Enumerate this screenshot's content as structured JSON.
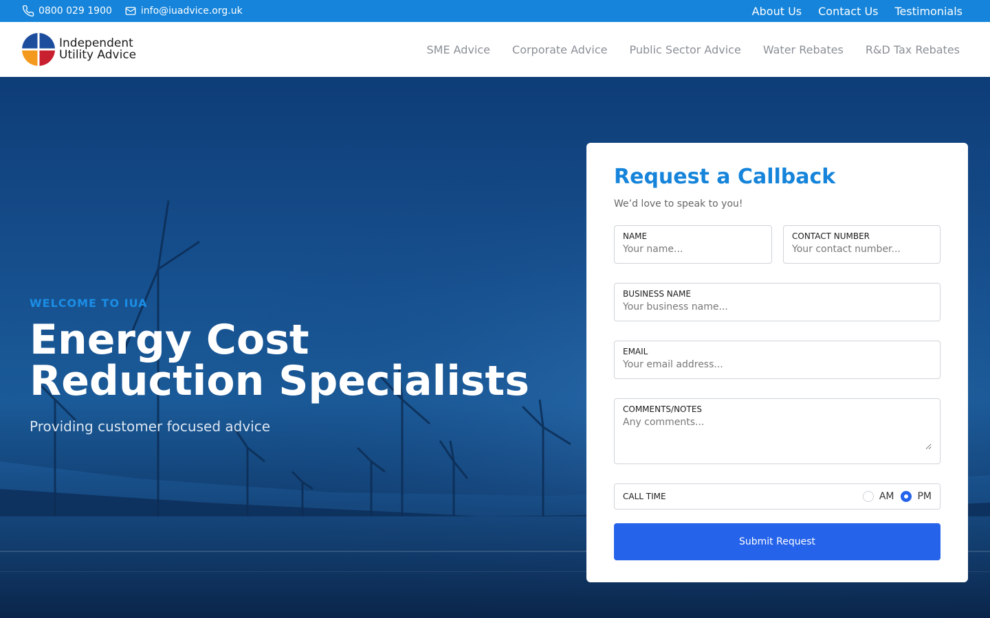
{
  "topbar": {
    "phone": "0800 029 1900",
    "email": "info@iuadvice.org.uk",
    "links": [
      "About Us",
      "Contact Us",
      "Testimonials"
    ]
  },
  "header": {
    "logo_line1": "Independent",
    "logo_line2": "Utility Advice",
    "nav": [
      "SME Advice",
      "Corporate Advice",
      "Public Sector Advice",
      "Water Rebates",
      "R&D Tax Rebates"
    ]
  },
  "hero": {
    "eyebrow": "WELCOME TO IUA",
    "title_line1": "Energy Cost",
    "title_line2": "Reduction Specialists",
    "subtitle": "Providing customer focused advice"
  },
  "form": {
    "title": "Request a Callback",
    "subtitle": "We’d love to speak to you!",
    "name_label": "NAME",
    "name_placeholder": "Your name...",
    "contact_label": "CONTACT NUMBER",
    "contact_placeholder": "Your contact number...",
    "business_label": "BUSINESS NAME",
    "business_placeholder": "Your business name...",
    "email_label": "EMAIL",
    "email_placeholder": "Your email address...",
    "comments_label": "COMMENTS/NOTES",
    "comments_placeholder": "Any comments...",
    "calltime_label": "CALL TIME",
    "am_label": "AM",
    "pm_label": "PM",
    "selected_time": "PM",
    "submit_label": "Submit Request"
  },
  "colors": {
    "topbar": "#1584da",
    "accent": "#1584da",
    "button": "#2563eb"
  },
  "icons": [
    "phone-icon",
    "mail-icon"
  ]
}
